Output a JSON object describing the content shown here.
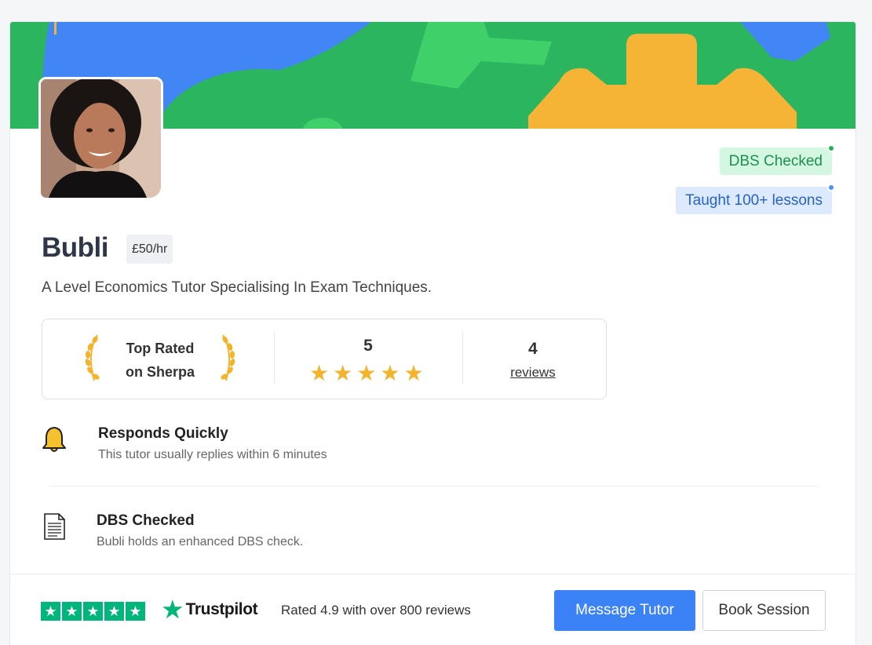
{
  "profile": {
    "name": "Bubli",
    "rate": "£50/hr",
    "headline": "A Level Economics Tutor Specialising In Exam Techniques."
  },
  "badges": {
    "dbs": "DBS Checked",
    "lessons": "Taught 100+ lessons"
  },
  "stats": {
    "top_rated_line1": "Top Rated",
    "top_rated_line2": "on Sherpa",
    "rating": "5",
    "stars": 5,
    "review_count": "4",
    "reviews_label": "reviews"
  },
  "features": [
    {
      "icon": "bell-icon",
      "title": "Responds Quickly",
      "description": "This tutor usually replies within 6 minutes"
    },
    {
      "icon": "document-icon",
      "title": "DBS Checked",
      "description": "Bubli holds an enhanced DBS check."
    }
  ],
  "footer": {
    "trustpilot_brand": "Trustpilot",
    "trustpilot_rating": "Rated 4.9 with over 800 reviews",
    "message_button": "Message Tutor",
    "book_button": "Book Session"
  },
  "colors": {
    "banner_green": "#2bb55f",
    "banner_blue": "#4285f4",
    "banner_orange": "#f6b437",
    "primary_blue": "#3b82f6",
    "trustpilot_green": "#00b67a",
    "star_gold": "#f4b32b"
  }
}
